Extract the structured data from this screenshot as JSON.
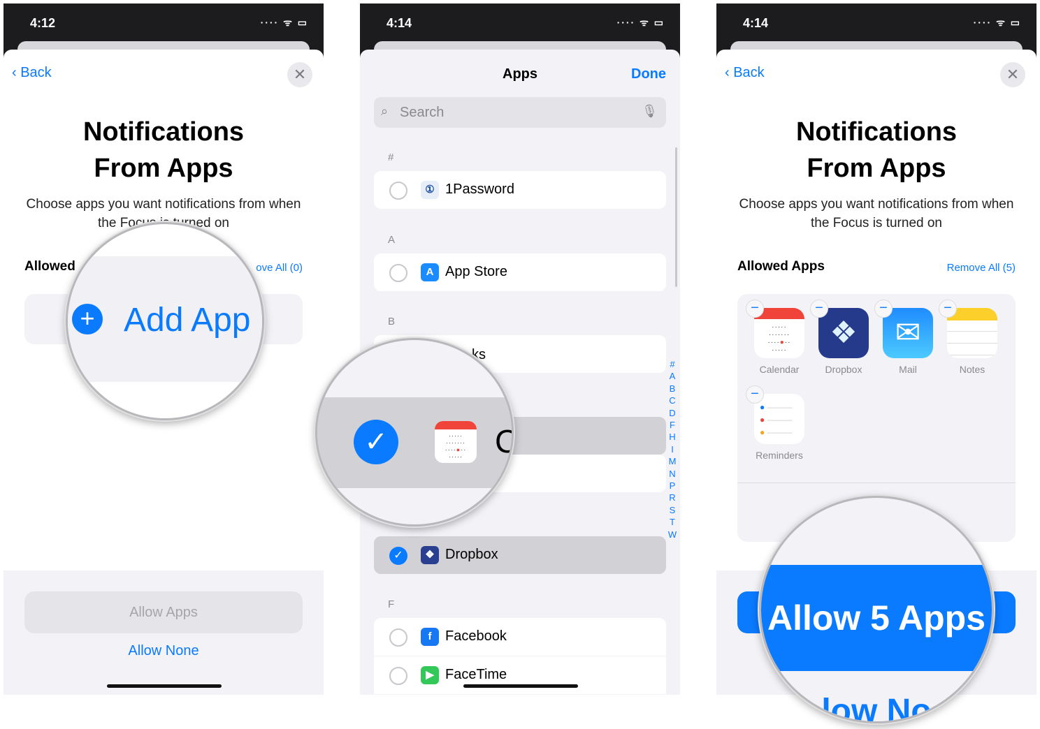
{
  "panels": [
    {
      "time": "4:12",
      "back": "Back",
      "title_line1": "Notifications",
      "title_line2": "From Apps",
      "description": "Choose apps you want notifications from when the Focus is turned on",
      "allowed_label": "Allowed",
      "remove_all": "ove All (0)",
      "add_app": "Add App",
      "allow_button": "Allow Apps",
      "allow_none": "Allow None"
    },
    {
      "time": "4:14",
      "title": "Apps",
      "done": "Done",
      "search_placeholder": "Search",
      "sections": [
        "#",
        "A",
        "B",
        "F"
      ],
      "rows": [
        {
          "name": "1Password",
          "checked": false
        },
        {
          "name": "App Store",
          "checked": false
        },
        {
          "name": "ks",
          "checked": false
        },
        {
          "name": "C",
          "checked": true
        },
        {
          "name": "Dropbox",
          "checked": true
        },
        {
          "name": "Facebook",
          "checked": false
        },
        {
          "name": "FaceTime",
          "checked": false
        }
      ],
      "index": [
        "#",
        "A",
        "B",
        "C",
        "D",
        "F",
        "H",
        "I",
        "M",
        "N",
        "P",
        "R",
        "S",
        "T",
        "W"
      ]
    },
    {
      "time": "4:14",
      "back": "Back",
      "title_line1": "Notifications",
      "title_line2": "From Apps",
      "description": "Choose apps you want notifications from when the Focus is turned on",
      "allowed_label": "Allowed Apps",
      "remove_all": "Remove All (5)",
      "apps": [
        "Calendar",
        "Dropbox",
        "Mail",
        "Notes",
        "Reminders"
      ],
      "allow_button": "Allow 5 Apps",
      "allow_none_partial": "low No"
    }
  ],
  "colors": {
    "accent": "#0a7aff"
  }
}
